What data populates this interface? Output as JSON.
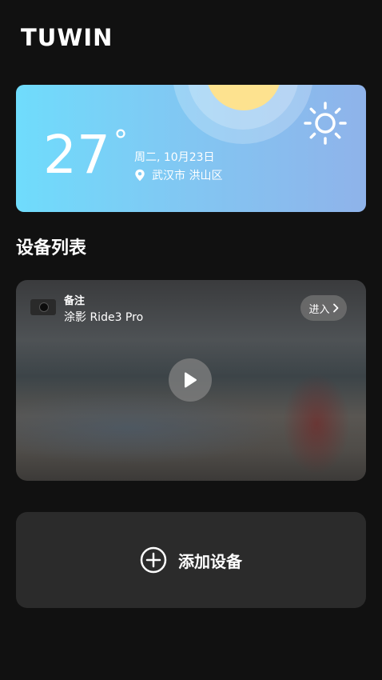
{
  "header": {
    "logo_text": "TUWIN"
  },
  "weather": {
    "temperature": "27",
    "degree_symbol": "°",
    "date": "周二, 10月23日",
    "location": "武汉市 洪山区",
    "condition_icon": "sun-icon",
    "location_icon": "pin-icon"
  },
  "section": {
    "title": "设备列表"
  },
  "device": {
    "note": "备注",
    "name": "涂影 Ride3 Pro",
    "enter_label": "进入",
    "enter_icon": "chevron-right-icon",
    "thumbnail_icon": "dashcam-icon",
    "play_icon": "play-icon"
  },
  "add_device": {
    "label": "添加设备",
    "icon": "plus-circle-icon"
  },
  "colors": {
    "background": "#111111",
    "card": "#2b2b2b",
    "weather_gradient_start": "#6fdcfc",
    "weather_gradient_end": "#8fb3ea",
    "sun": "#fde28f"
  }
}
